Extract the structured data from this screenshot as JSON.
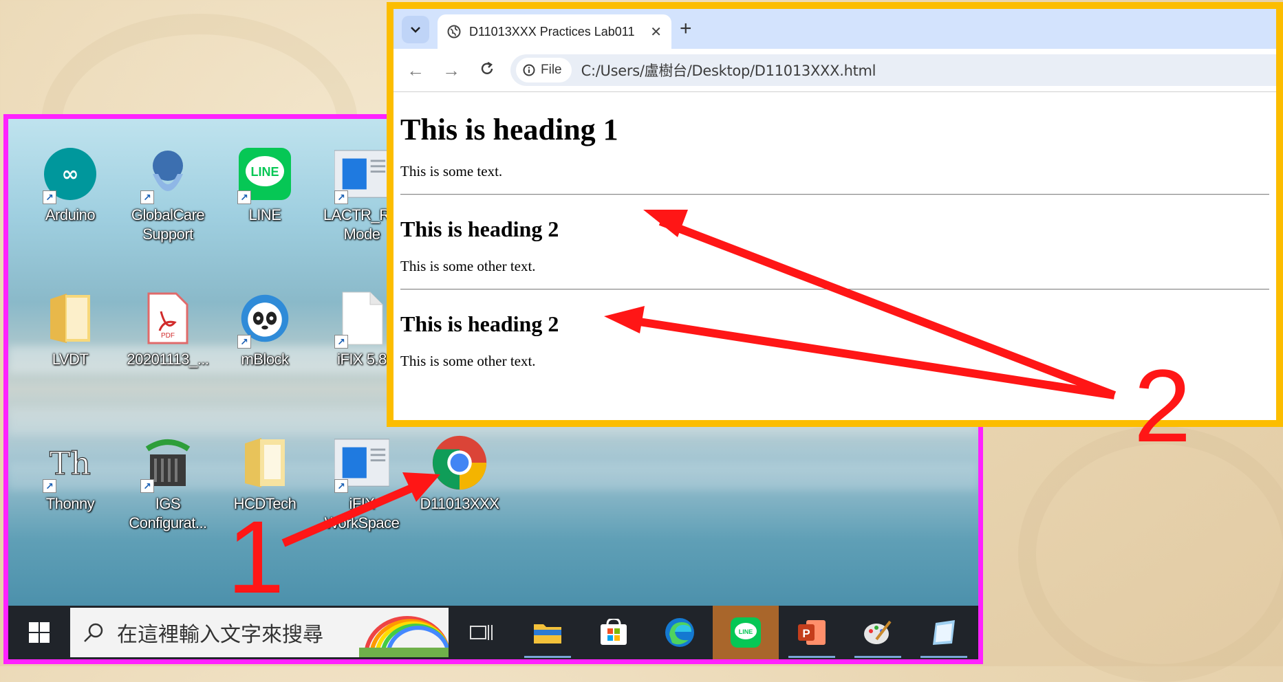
{
  "desktop": {
    "icons": [
      {
        "label_lines": [
          "Arduino"
        ],
        "icon": "arduino-icon"
      },
      {
        "label_lines": [
          "GlobalCare",
          "Support"
        ],
        "icon": "globalcare-icon"
      },
      {
        "label_lines": [
          "LINE"
        ],
        "icon": "line-app-icon"
      },
      {
        "label_lines": [
          "LACTR_RU",
          "Mode"
        ],
        "icon": "app-window-icon"
      },
      {
        "label_lines": [
          "LVDT"
        ],
        "icon": "folder-icon"
      },
      {
        "label_lines": [
          "20201113_..."
        ],
        "icon": "pdf-file-icon"
      },
      {
        "label_lines": [
          "mBlock"
        ],
        "icon": "mblock-panda-icon"
      },
      {
        "label_lines": [
          "iFIX 5.8"
        ],
        "icon": "blank-file-icon"
      },
      {
        "label_lines": [
          "Thonny"
        ],
        "icon": "thonny-icon"
      },
      {
        "label_lines": [
          "IGS",
          "Configurat..."
        ],
        "icon": "igs-server-icon"
      },
      {
        "label_lines": [
          "HCDTech"
        ],
        "icon": "folder-icon"
      },
      {
        "label_lines": [
          "iFIX",
          "WorkSpace"
        ],
        "icon": "app-window-icon"
      },
      {
        "label_lines": [
          "D11013XXX"
        ],
        "icon": "chrome-icon"
      }
    ]
  },
  "taskbar": {
    "search_placeholder": "在這裡輸入文字來搜尋",
    "items": [
      "task-view-icon",
      "file-explorer-icon",
      "microsoft-store-icon",
      "edge-icon",
      "line-app-icon",
      "powerpoint-icon",
      "paint-icon",
      "notepad-icon"
    ],
    "active_item": "line-app-icon"
  },
  "browser": {
    "tab_title": "D11013XXX Practices Lab011",
    "tab_close": "✕",
    "new_tab": "+",
    "dropdown": "⌄",
    "file_chip": "File",
    "url": "C:/Users/盧樹台/Desktop/D11013XXX.html"
  },
  "page": {
    "h1": "This is heading 1",
    "p1": "This is some text.",
    "h2a": "This is heading 2",
    "p2": "This is some other text.",
    "h2b": "This is heading 2",
    "p3": "This is some other text."
  },
  "annotations": {
    "label_1": "1",
    "label_2": "2",
    "color": "#ff1616",
    "desktop_border": "#ff22ff",
    "browser_border": "#fcbd00"
  }
}
